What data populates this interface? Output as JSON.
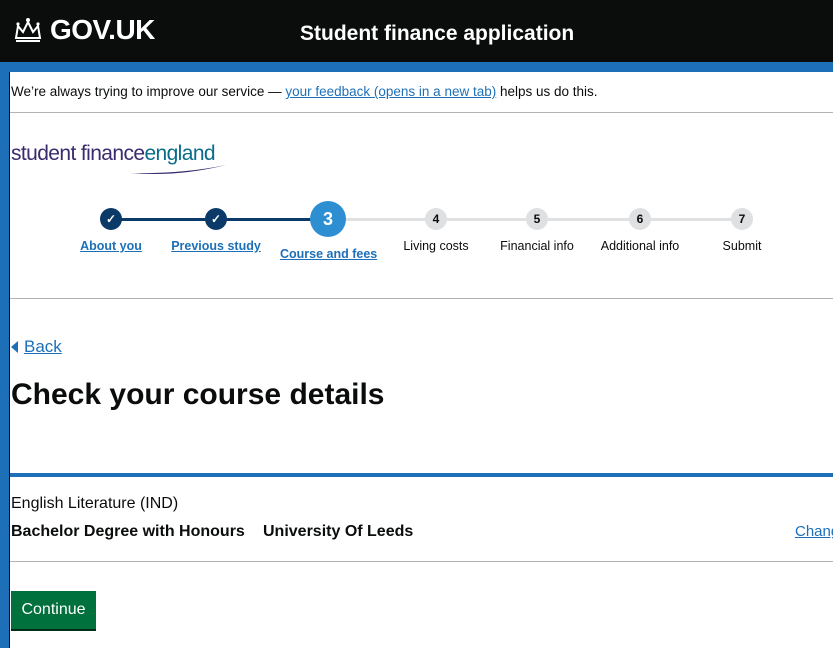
{
  "header": {
    "logo_text": "GOV.UK",
    "service_name": "Student finance application"
  },
  "feedback": {
    "prefix": "We’re always trying to improve our service — ",
    "link": "your feedback (opens in a new tab)",
    "suffix": " helps us do this."
  },
  "brand": {
    "word1": "student finance",
    "word2": "england"
  },
  "progress": {
    "steps": [
      {
        "number": "",
        "label": "About you",
        "state": "done"
      },
      {
        "number": "",
        "label": "Previous study",
        "state": "done"
      },
      {
        "number": "3",
        "label": "Course and fees",
        "state": "current"
      },
      {
        "number": "4",
        "label": "Living costs",
        "state": "todo"
      },
      {
        "number": "5",
        "label": "Financial info",
        "state": "todo"
      },
      {
        "number": "6",
        "label": "Additional info",
        "state": "todo"
      },
      {
        "number": "7",
        "label": "Submit",
        "state": "todo"
      }
    ]
  },
  "back_label": "Back",
  "page_title": "Check your course details",
  "course": {
    "name": "English Literature (IND)",
    "qualification": "Bachelor Degree with Honours",
    "university": "University Of Leeds",
    "change_label": "Change"
  },
  "continue_label": "Continue",
  "colors": {
    "brand_blue": "#1d70b8",
    "done_step": "#0b3a68",
    "current_step": "#2d8fd1",
    "button_green": "#00703c"
  }
}
